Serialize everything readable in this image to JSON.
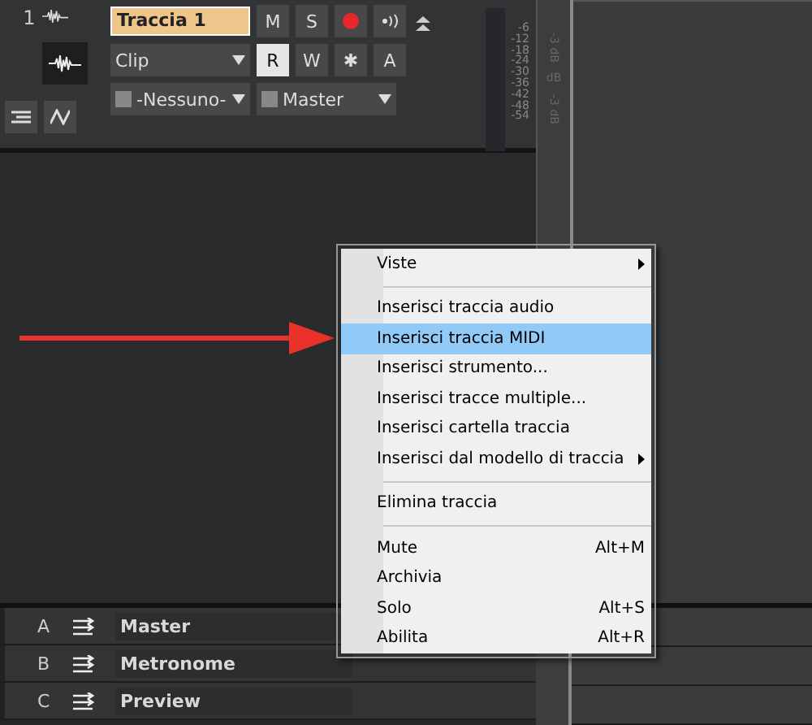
{
  "track": {
    "number": "1",
    "name": "Traccia 1",
    "buttons": [
      {
        "label": "M",
        "kind": "text",
        "selected": false
      },
      {
        "label": "S",
        "kind": "text",
        "selected": false
      },
      {
        "kind": "record",
        "selected": false
      },
      {
        "kind": "monitor",
        "selected": false
      }
    ],
    "clip": "Clip",
    "buttons2": [
      {
        "label": "R",
        "selected": true
      },
      {
        "label": "W",
        "selected": false
      },
      {
        "label": "✱",
        "selected": false
      },
      {
        "label": "A",
        "selected": false
      }
    ],
    "input": "-Nessuno-",
    "output": "Master",
    "meter_ticks": [
      "-6",
      "-12",
      "-18",
      "-24",
      "-30",
      "-36",
      "-42",
      "-48",
      "-54"
    ]
  },
  "splitter_labels": [
    "-3 dB",
    "dB",
    "-3 dB"
  ],
  "buses": [
    {
      "letter": "A",
      "name": "Master"
    },
    {
      "letter": "B",
      "name": "Metronome"
    },
    {
      "letter": "C",
      "name": "Preview"
    }
  ],
  "menu": {
    "items": [
      {
        "kind": "item",
        "label": "Viste",
        "submenu": true,
        "selected": false
      },
      {
        "kind": "separator"
      },
      {
        "kind": "item",
        "label": "Inserisci traccia audio",
        "submenu": false,
        "selected": false
      },
      {
        "kind": "item",
        "label": "Inserisci traccia MIDI",
        "submenu": false,
        "selected": true
      },
      {
        "kind": "item",
        "label": "Inserisci strumento...",
        "submenu": false,
        "selected": false
      },
      {
        "kind": "item",
        "label": "Inserisci tracce multiple...",
        "submenu": false,
        "selected": false
      },
      {
        "kind": "item",
        "label": "Inserisci cartella traccia",
        "submenu": false,
        "selected": false
      },
      {
        "kind": "item",
        "label": "Inserisci dal modello di traccia",
        "submenu": true,
        "selected": false
      },
      {
        "kind": "separator"
      },
      {
        "kind": "item",
        "label": "Elimina traccia",
        "submenu": false,
        "selected": false
      },
      {
        "kind": "separator"
      },
      {
        "kind": "item",
        "label": "Mute",
        "shortcut": "Alt+M",
        "submenu": false,
        "selected": false
      },
      {
        "kind": "item",
        "label": "Archivia",
        "submenu": false,
        "selected": false
      },
      {
        "kind": "item",
        "label": "Solo",
        "shortcut": "Alt+S",
        "submenu": false,
        "selected": false
      },
      {
        "kind": "item",
        "label": "Abilita",
        "shortcut": "Alt+R",
        "submenu": false,
        "selected": false
      }
    ]
  }
}
